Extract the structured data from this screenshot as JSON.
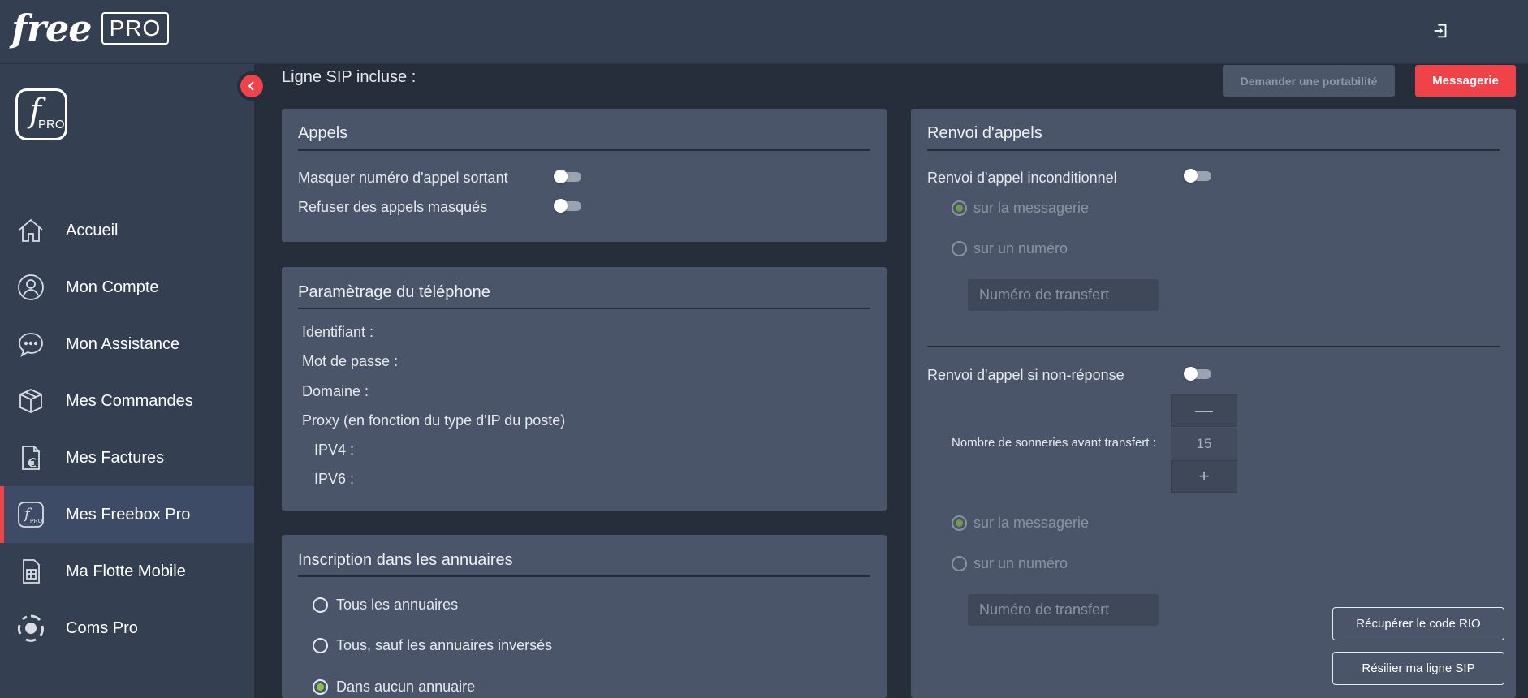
{
  "header": {
    "brand_free": "free",
    "brand_pro": "PRO",
    "logout_icon": "logout-icon"
  },
  "sidebar": {
    "logo": {
      "f": "f",
      "pro": "PRO"
    },
    "items": [
      {
        "label": "Accueil",
        "icon": "home-icon"
      },
      {
        "label": "Mon Compte",
        "icon": "user-icon"
      },
      {
        "label": "Mon Assistance",
        "icon": "chat-icon"
      },
      {
        "label": "Mes Commandes",
        "icon": "box-icon"
      },
      {
        "label": "Mes Factures",
        "icon": "invoice-euro-icon"
      },
      {
        "label": "Mes Freebox Pro",
        "icon": "freebox-pro-icon",
        "active": true
      },
      {
        "label": "Ma Flotte Mobile",
        "icon": "sim-card-icon"
      },
      {
        "label": "Coms Pro",
        "icon": "coms-pro-icon"
      }
    ]
  },
  "main": {
    "title": "Ligne SIP incluse :",
    "btn_portability": "Demander une portabilité",
    "btn_messagerie": "Messagerie",
    "appels": {
      "title": "Appels",
      "mask_outgoing": "Masquer numéro d'appel sortant",
      "refuse_masked": "Refuser des appels masqués"
    },
    "phone_settings": {
      "title": "Paramètrage du téléphone",
      "identifiant": "Identifiant :",
      "password": "Mot de passe :",
      "domain": "Domaine :",
      "proxy": "Proxy (en fonction du type d'IP du poste)",
      "ipv4": "IPV4 :",
      "ipv6": "IPV6 :"
    },
    "annuaires": {
      "title": "Inscription dans les annuaires",
      "options": [
        "Tous les annuaires",
        "Tous, sauf les annuaires inversés",
        "Dans aucun annuaire"
      ],
      "selected_index": 2
    },
    "renvoi": {
      "title": "Renvoi d'appels",
      "unconditional": "Renvoi d'appel inconditionnel",
      "no_answer": "Renvoi d'appel si non-réponse",
      "opt_voicemail": "sur la messagerie",
      "opt_number": "sur un numéro",
      "transfer_placeholder": "Numéro de transfert",
      "rings_label": "Nombre de sonneries avant transfert :",
      "rings_value": "15",
      "minus": "—",
      "plus": "+"
    },
    "btn_rio": "Récupérer le code RIO",
    "btn_cancel_line": "Résilier ma ligne SIP"
  }
}
